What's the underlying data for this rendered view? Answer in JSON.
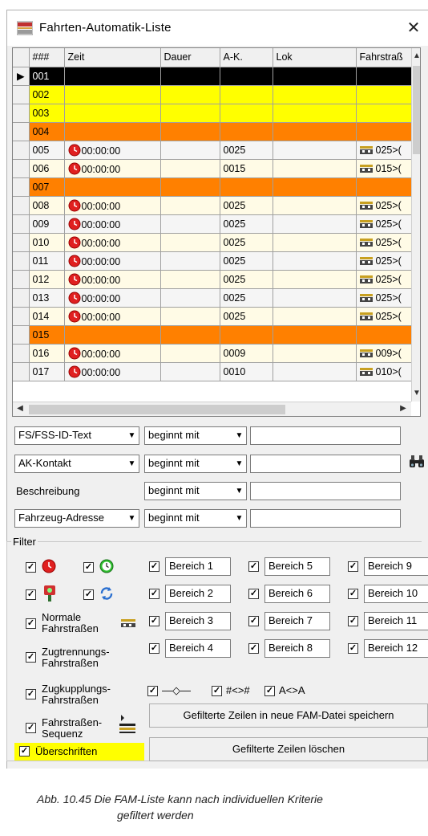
{
  "window": {
    "title": "Fahrten-Automatik-Liste",
    "close_glyph": "✕",
    "icon": "app-icon"
  },
  "grid": {
    "columns": [
      "###",
      "Zeit",
      "Dauer",
      "A-K.",
      "Lok",
      "Fahrstraß"
    ],
    "rows": [
      {
        "id": "001",
        "style": "black",
        "zeit": "",
        "ak": "",
        "fs": ""
      },
      {
        "id": "002",
        "style": "yellow",
        "zeit": "",
        "ak": "",
        "fs": ""
      },
      {
        "id": "003",
        "style": "yellow",
        "zeit": "",
        "ak": "",
        "fs": ""
      },
      {
        "id": "004",
        "style": "orange",
        "zeit": "",
        "ak": "",
        "fs": ""
      },
      {
        "id": "005",
        "style": "data",
        "zeit": "00:00:00",
        "ak": "0025",
        "fs": "025>("
      },
      {
        "id": "006",
        "style": "data",
        "zeit": "00:00:00",
        "ak": "0015",
        "fs": "015>("
      },
      {
        "id": "007",
        "style": "orange",
        "zeit": "",
        "ak": "",
        "fs": ""
      },
      {
        "id": "008",
        "style": "data",
        "zeit": "00:00:00",
        "ak": "0025",
        "fs": "025>("
      },
      {
        "id": "009",
        "style": "data",
        "zeit": "00:00:00",
        "ak": "0025",
        "fs": "025>("
      },
      {
        "id": "010",
        "style": "data",
        "zeit": "00:00:00",
        "ak": "0025",
        "fs": "025>("
      },
      {
        "id": "011",
        "style": "data",
        "zeit": "00:00:00",
        "ak": "0025",
        "fs": "025>("
      },
      {
        "id": "012",
        "style": "data",
        "zeit": "00:00:00",
        "ak": "0025",
        "fs": "025>("
      },
      {
        "id": "013",
        "style": "data",
        "zeit": "00:00:00",
        "ak": "0025",
        "fs": "025>("
      },
      {
        "id": "014",
        "style": "data",
        "zeit": "00:00:00",
        "ak": "0025",
        "fs": "025>("
      },
      {
        "id": "015",
        "style": "orange",
        "zeit": "",
        "ak": "",
        "fs": ""
      },
      {
        "id": "016",
        "style": "data",
        "zeit": "00:00:00",
        "ak": "0009",
        "fs": "009>("
      },
      {
        "id": "017",
        "style": "data",
        "zeit": "00:00:00",
        "ak": "0010",
        "fs": "010>("
      }
    ],
    "row_marker": "▶"
  },
  "search": {
    "rows": [
      {
        "field": "FS/FSS-ID-Text",
        "mode": "beginnt mit"
      },
      {
        "field": "AK-Kontakt",
        "mode": "beginnt mit"
      },
      {
        "field": "Beschreibung",
        "mode": "beginnt mit"
      },
      {
        "field": "Fahrzeug-Adresse",
        "mode": "beginnt mit"
      }
    ]
  },
  "filter": {
    "legend": "Filter",
    "bereiche": [
      "Bereich 1",
      "Bereich 2",
      "Bereich 3",
      "Bereich 4",
      "Bereich 5",
      "Bereich 6",
      "Bereich 7",
      "Bereich 8",
      "Bereich 9",
      "Bereich 10",
      "Bereich 11",
      "Bereich 12"
    ],
    "normale": "Normale Fahrstraßen",
    "zugtrennung": "Zugtrennungs-Fahrstraßen",
    "zugkupplung": "Zugkupplungs-Fahrstraßen",
    "sequenz": "Fahrstraßen-Sequenz",
    "ueberschriften": "Überschriften",
    "sym_arrow": "—◇—",
    "sym_hash": "#<>#",
    "sym_ak": "A<>A",
    "check": "✓",
    "btn_save": "Gefilterte Zeilen in neue FAM-Datei speichern",
    "btn_delete": "Gefilterte Zeilen löschen"
  },
  "caption": {
    "line1": "Abb. 10.45  Die  FAM-Liste  kann  nach  individuellen  Kriterie",
    "line2": "gefiltert werden"
  },
  "colors": {
    "yellow": "#ffff00",
    "orange": "#ff8000",
    "clock_red": "#e02020"
  }
}
